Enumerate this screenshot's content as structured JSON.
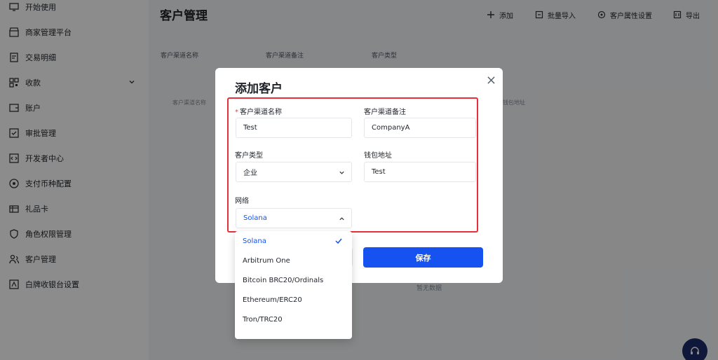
{
  "sidebar": {
    "items": [
      {
        "label": "开始使用",
        "icon": "monitor-icon"
      },
      {
        "label": "商家管理平台",
        "icon": "store-icon"
      },
      {
        "label": "交易明细",
        "icon": "receipt-icon"
      },
      {
        "label": "收款",
        "icon": "qrcode-icon",
        "expandable": true
      },
      {
        "label": "账户",
        "icon": "wallet-icon"
      },
      {
        "label": "审批管理",
        "icon": "approval-icon"
      },
      {
        "label": "开发者中心",
        "icon": "code-icon"
      },
      {
        "label": "支付币种配置",
        "icon": "coin-icon"
      },
      {
        "label": "礼品卡",
        "icon": "giftcard-icon"
      },
      {
        "label": "角色权限管理",
        "icon": "shield-icon"
      },
      {
        "label": "客户管理",
        "icon": "users-icon"
      },
      {
        "label": "白牌收银台设置",
        "icon": "settings-icon"
      }
    ]
  },
  "header": {
    "title": "客户管理",
    "actions": [
      {
        "label": "添加",
        "icon": "plus-icon"
      },
      {
        "label": "批量导入",
        "icon": "import-icon"
      },
      {
        "label": "客户属性设置",
        "icon": "gear-icon"
      },
      {
        "label": "导出",
        "icon": "export-icon"
      }
    ]
  },
  "filters": {
    "labels": [
      "客户渠道名称",
      "客户渠道备注",
      "客户类型"
    ]
  },
  "table": {
    "columns": [
      "客户渠道名称",
      "钱包地址"
    ],
    "empty_text": "暂无数据"
  },
  "modal": {
    "title": "添加客户",
    "required_mark": "*",
    "fields": {
      "channel_name": {
        "label": "客户渠道名称",
        "value": "Test"
      },
      "channel_note": {
        "label": "客户渠道备注",
        "value": "CompanyA"
      },
      "customer_type": {
        "label": "客户类型",
        "value": "企业"
      },
      "wallet_address": {
        "label": "钱包地址",
        "value": "Test"
      },
      "network": {
        "label": "网络",
        "value": "Solana"
      }
    },
    "save_label": "保存"
  },
  "network_dropdown": {
    "options": [
      "Solana",
      "Arbitrum One",
      "Bitcoin BRC20/Ordinals",
      "Ethereum/ERC20",
      "Tron/TRC20"
    ],
    "selected_index": 0
  },
  "colors": {
    "primary": "#1652f0",
    "highlight_border": "#e5303a",
    "required": "#f53f3f"
  }
}
